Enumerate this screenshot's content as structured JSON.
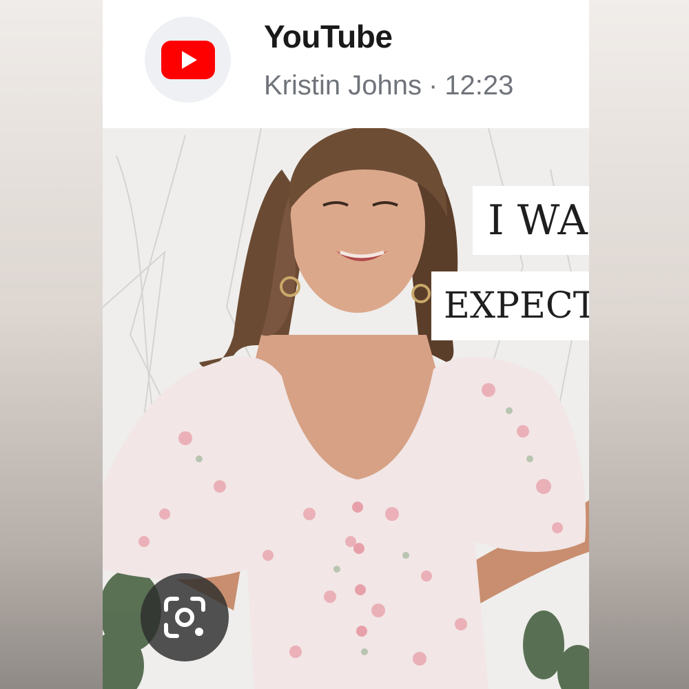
{
  "header": {
    "app_name": "YouTube",
    "channel": "Kristin Johns",
    "separator": "·",
    "time": "12:23",
    "logo_icon": "youtube-logo-icon",
    "brand_color": "#FF0000"
  },
  "thumbnail": {
    "caption_line1": "I WA",
    "caption_line2": "EXPECT"
  },
  "actions": {
    "lens_icon": "google-lens-icon"
  }
}
